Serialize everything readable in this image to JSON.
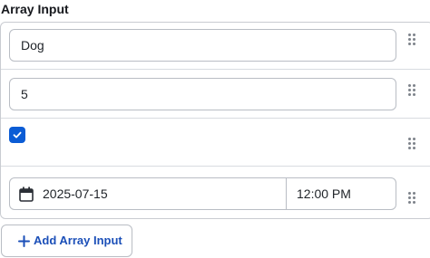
{
  "section": {
    "title": "Array Input"
  },
  "items": [
    {
      "type": "text",
      "value": "Dog"
    },
    {
      "type": "number",
      "value": "5"
    },
    {
      "type": "checkbox",
      "checked": true
    },
    {
      "type": "datetime",
      "date": "2025-07-15",
      "time": "12:00 PM"
    }
  ],
  "icons": {
    "drag": "drag-handle-icon",
    "calendar": "calendar-icon",
    "check": "checkmark-icon",
    "add": "plus-icon"
  },
  "colors": {
    "accent": "#0b5cd5",
    "link": "#1b4fb8",
    "border": "#b9bdc4"
  },
  "add_button": {
    "label": "Add Array Input"
  }
}
